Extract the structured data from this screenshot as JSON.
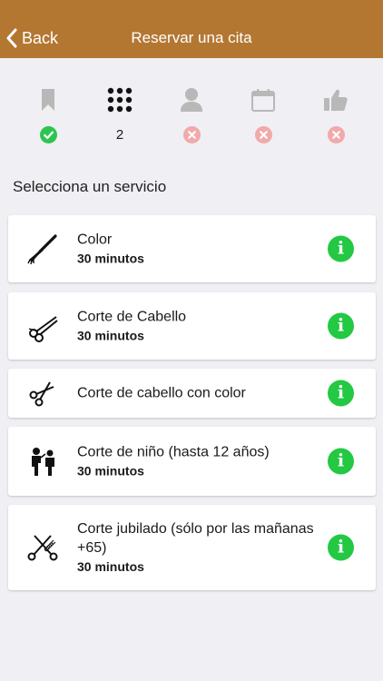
{
  "header": {
    "back_label": "Back",
    "title": "Reservar una cita",
    "bar_color": "#b37732"
  },
  "steps": [
    {
      "icon": "bookmark-icon",
      "status": "done"
    },
    {
      "icon": "grid-icon",
      "status": "current",
      "number": "2"
    },
    {
      "icon": "person-icon",
      "status": "pending"
    },
    {
      "icon": "calendar-icon",
      "status": "pending"
    },
    {
      "icon": "thumbs-up-icon",
      "status": "pending"
    }
  ],
  "section": {
    "title": "Selecciona un servicio"
  },
  "services": [
    {
      "icon": "brush-icon",
      "name": "Color",
      "duration": "30 minutos"
    },
    {
      "icon": "scissors-icon",
      "name": "Corte de Cabello",
      "duration": "30 minutos"
    },
    {
      "icon": "scissors-icon",
      "name": "Corte de cabello con color",
      "duration": ""
    },
    {
      "icon": "barber-icon",
      "name": "Corte de niño (hasta 12 años)",
      "duration": "30 minutos"
    },
    {
      "icon": "scissors-comb-icon",
      "name": "Corte jubilado (sólo por las mañanas +65)",
      "duration": "30 minutos"
    }
  ],
  "colors": {
    "success": "#2dc54f",
    "error": "#f2a9a9",
    "info": "#23c843",
    "icon_muted": "#b8b8b8"
  }
}
